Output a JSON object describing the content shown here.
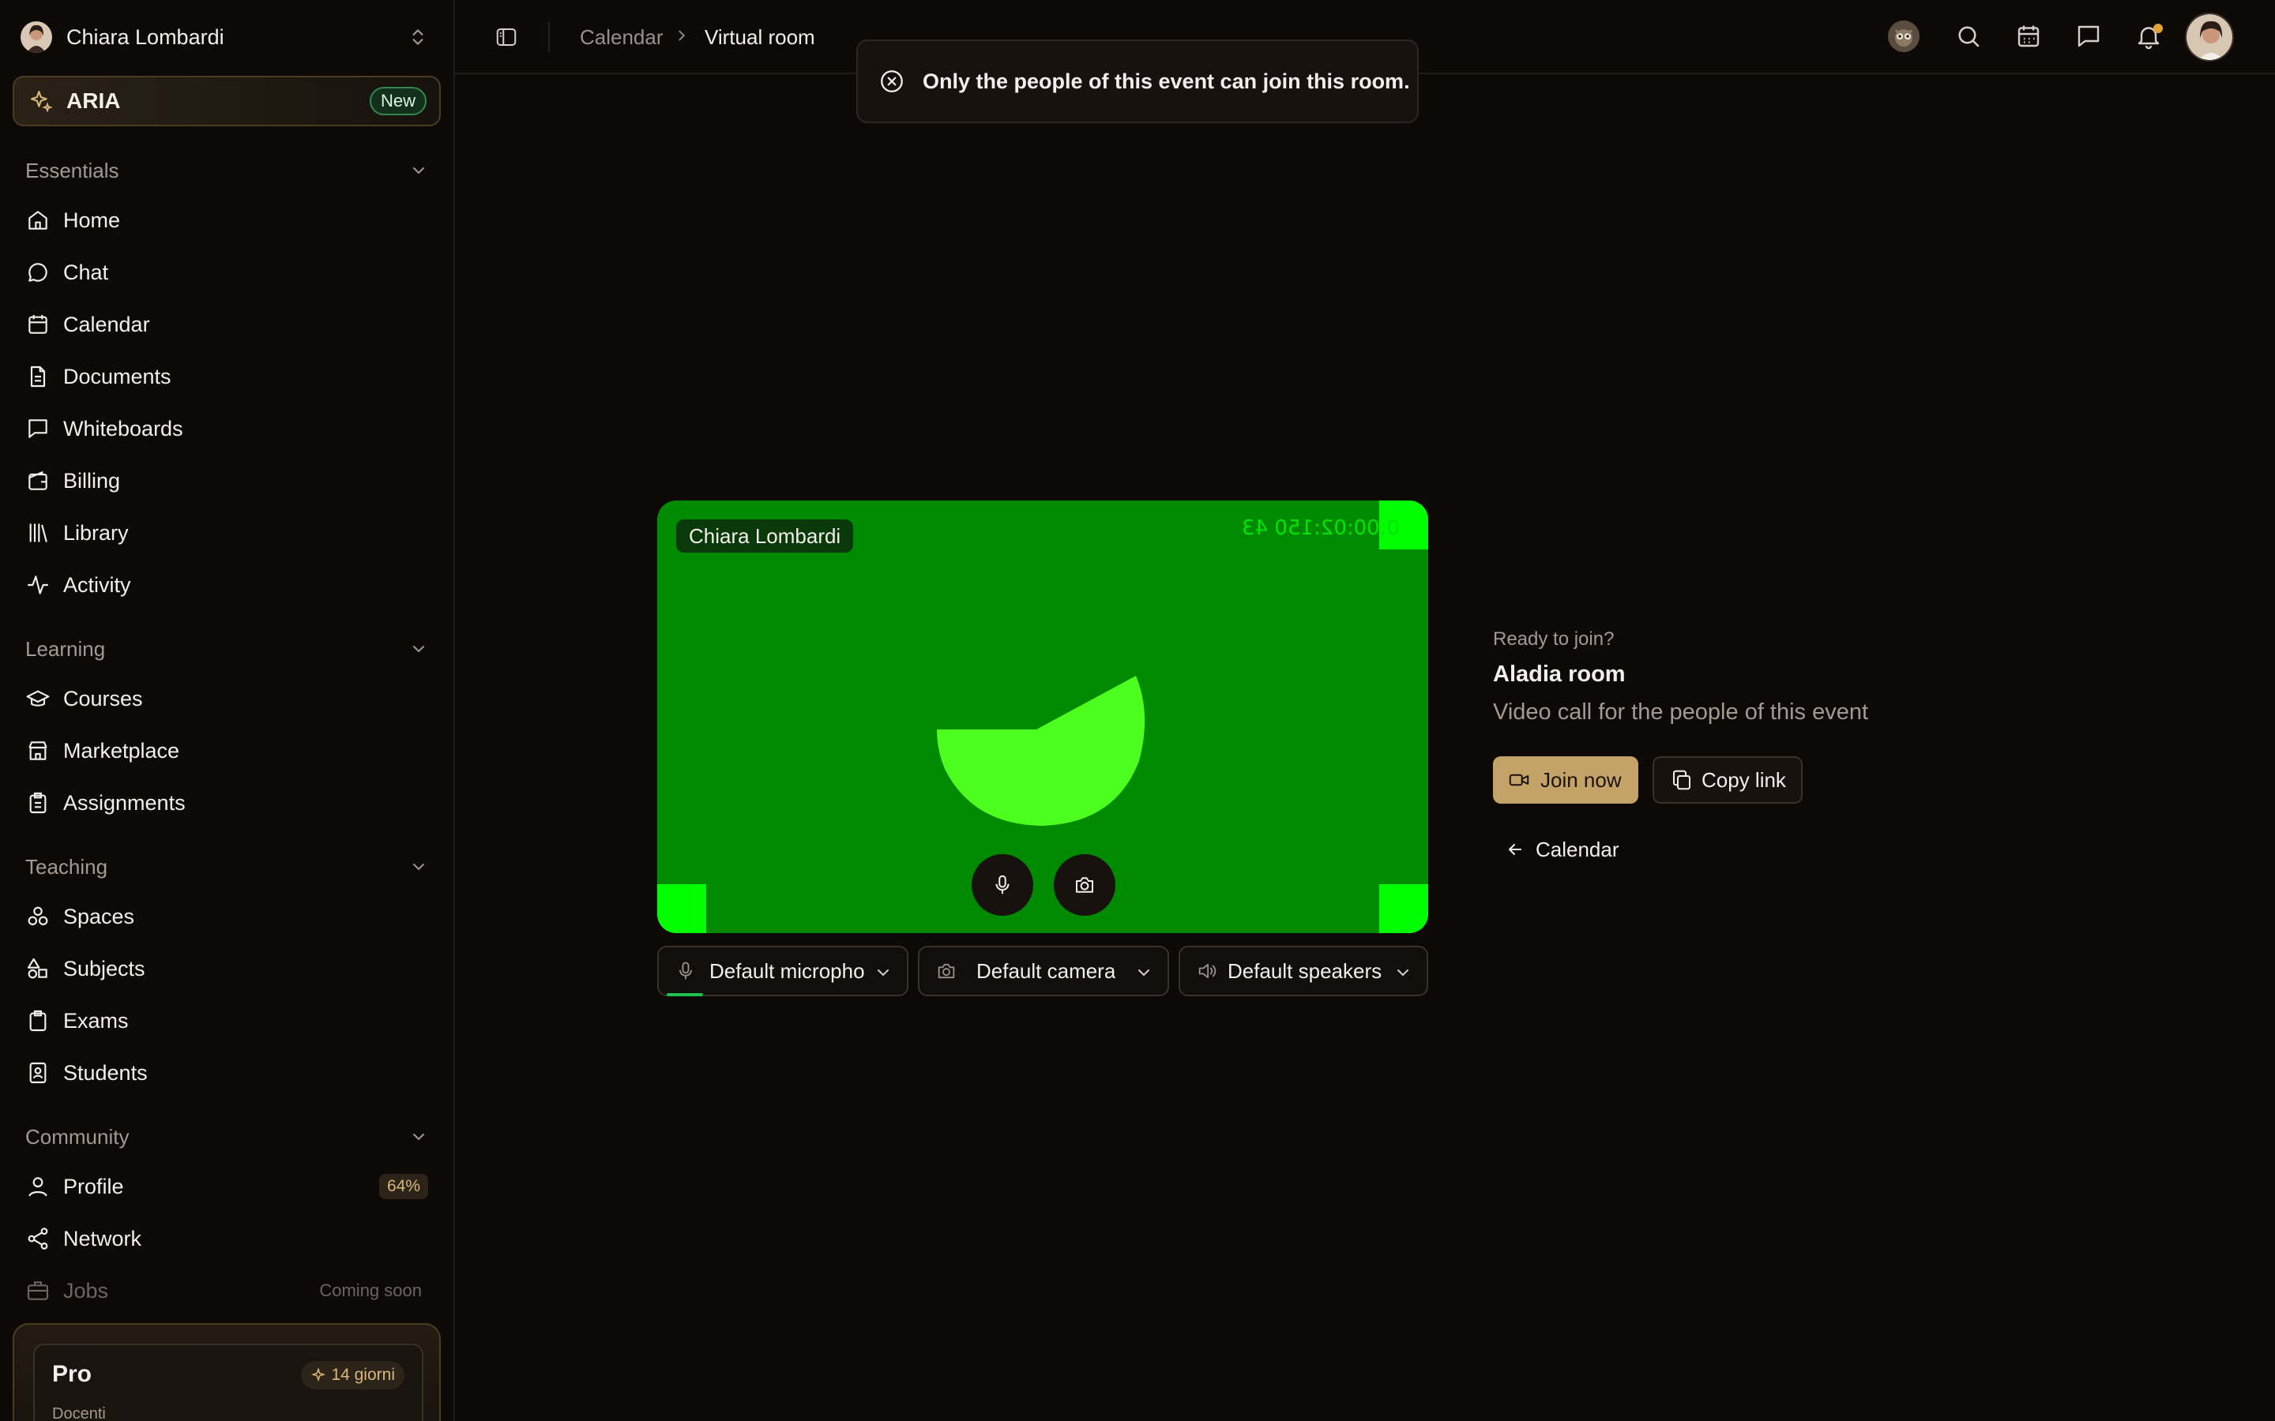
{
  "sidebar": {
    "user_name": "Chiara Lombardi",
    "aria": {
      "label": "ARIA",
      "badge": "New"
    },
    "sections": {
      "essentials": "Essentials",
      "learning": "Learning",
      "teaching": "Teaching",
      "community": "Community"
    },
    "essentials": [
      "Home",
      "Chat",
      "Calendar",
      "Documents",
      "Whiteboards",
      "Billing",
      "Library",
      "Activity"
    ],
    "learning": [
      "Courses",
      "Marketplace",
      "Assignments"
    ],
    "teaching": [
      "Spaces",
      "Subjects",
      "Exams",
      "Students"
    ],
    "community": {
      "profile": "Profile",
      "profile_progress": "64%",
      "network": "Network",
      "jobs": "Jobs",
      "jobs_status": "Coming soon"
    },
    "pro": {
      "title": "Pro",
      "trial": "14 giorni",
      "subtitle": "Docenti"
    }
  },
  "topbar": {
    "breadcrumb": [
      "Calendar",
      "Virtual room"
    ]
  },
  "toast": {
    "message": "Only the people of this event can join this room."
  },
  "video": {
    "participant": "Chiara Lombardi",
    "timecode": "0:00:02:150 43"
  },
  "devices": {
    "microphone": "Default micropho",
    "camera": "Default camera",
    "speakers": "Default speakers"
  },
  "join": {
    "ready": "Ready to join?",
    "room_name": "Aladia room",
    "description": "Video call for the people of this event",
    "join_label": "Join now",
    "copy_label": "Copy link",
    "back_label": "Calendar"
  },
  "colors": {
    "background": "#0d0906",
    "accent_gold": "#c4a368",
    "video_green": "#008a00",
    "marker_green": "#00ff00",
    "new_badge": "#2f8a4a"
  }
}
